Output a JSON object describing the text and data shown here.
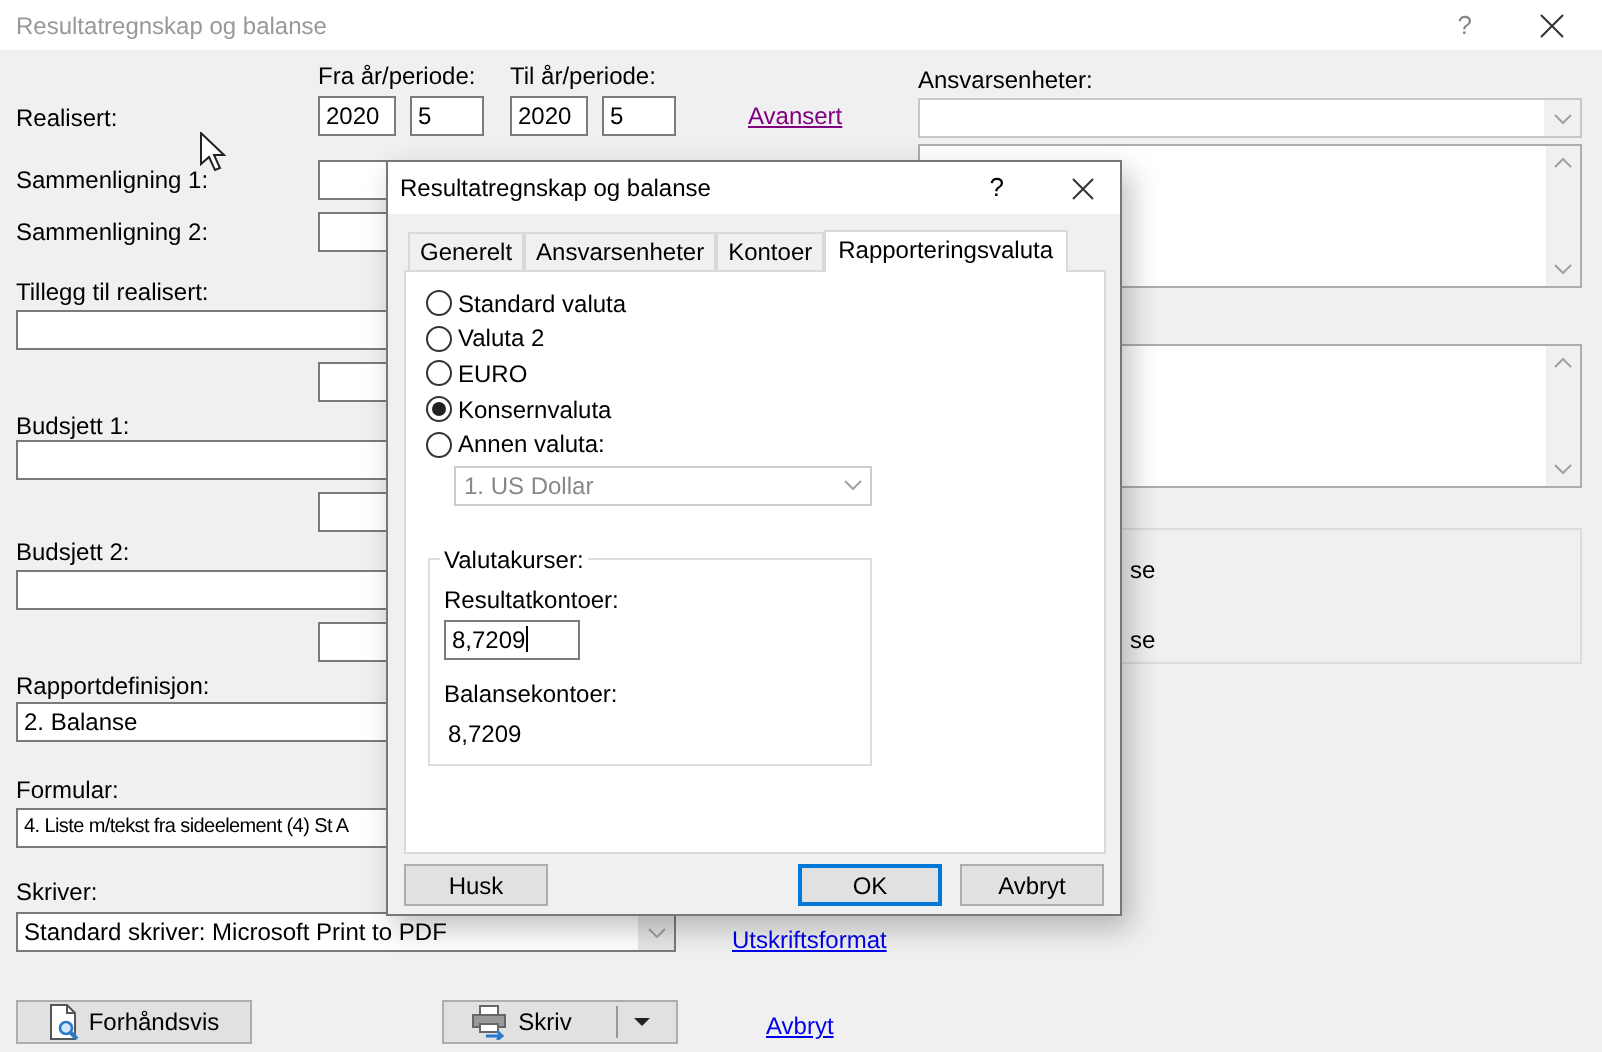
{
  "window": {
    "title": "Resultatregnskap og balanse",
    "help": "?"
  },
  "period_headers": [
    "Fra år/periode:",
    "Til år/periode:"
  ],
  "realisert": {
    "label": "Realisert:",
    "from_year": "2020",
    "from_period": "5",
    "to_year": "2020",
    "to_period": "5",
    "link": "Avansert"
  },
  "comparisons": [
    {
      "label": "Sammenligning 1:"
    },
    {
      "label": "Sammenligning 2:"
    }
  ],
  "additions": [
    {
      "label": "Tillegg til realisert:"
    },
    {
      "label": "Budsjett 1:"
    },
    {
      "label": "Budsjett 2:"
    }
  ],
  "report_definition": {
    "label": "Rapportdefinisjon:",
    "value": "2. Balanse"
  },
  "form": {
    "label": "Formular:",
    "value": "4. Liste m/tekst fra sideelement (4) St A"
  },
  "printer": {
    "label": "Skriver:",
    "value": "Standard skriver: Microsoft Print to PDF",
    "link": "Utskriftsformat"
  },
  "actions": {
    "preview": "Forhåndsvis",
    "print": "Skriv",
    "cancel": "Avbryt"
  },
  "units": {
    "label": "Ansvarsenheter:"
  },
  "group_options": [
    "se",
    "se"
  ],
  "dialog": {
    "title": "Resultatregnskap og balanse",
    "help": "?",
    "tabs": [
      {
        "label": "Generelt",
        "selected": false
      },
      {
        "label": "Ansvarsenheter",
        "selected": false
      },
      {
        "label": "Kontoer",
        "selected": false
      },
      {
        "label": "Rapporteringsvaluta",
        "selected": true
      }
    ],
    "currency_options": [
      {
        "label": "Standard valuta",
        "selected": false
      },
      {
        "label": "Valuta 2",
        "selected": false
      },
      {
        "label": "EURO",
        "selected": false
      },
      {
        "label": "Konsernvaluta",
        "selected": true
      },
      {
        "label": "Annen valuta:",
        "selected": false
      }
    ],
    "other_currency": {
      "value": "1. US Dollar",
      "disabled": true
    },
    "rates": {
      "legend": "Valutakurser:",
      "result_label": "Resultatkontoer:",
      "result_value": "8,7209",
      "balance_label": "Balansekontoer:",
      "balance_value": "8,7209"
    },
    "buttons": [
      {
        "label": "Husk",
        "default": false
      },
      {
        "label": "OK",
        "default": true
      },
      {
        "label": "Avbryt",
        "default": false
      }
    ]
  }
}
